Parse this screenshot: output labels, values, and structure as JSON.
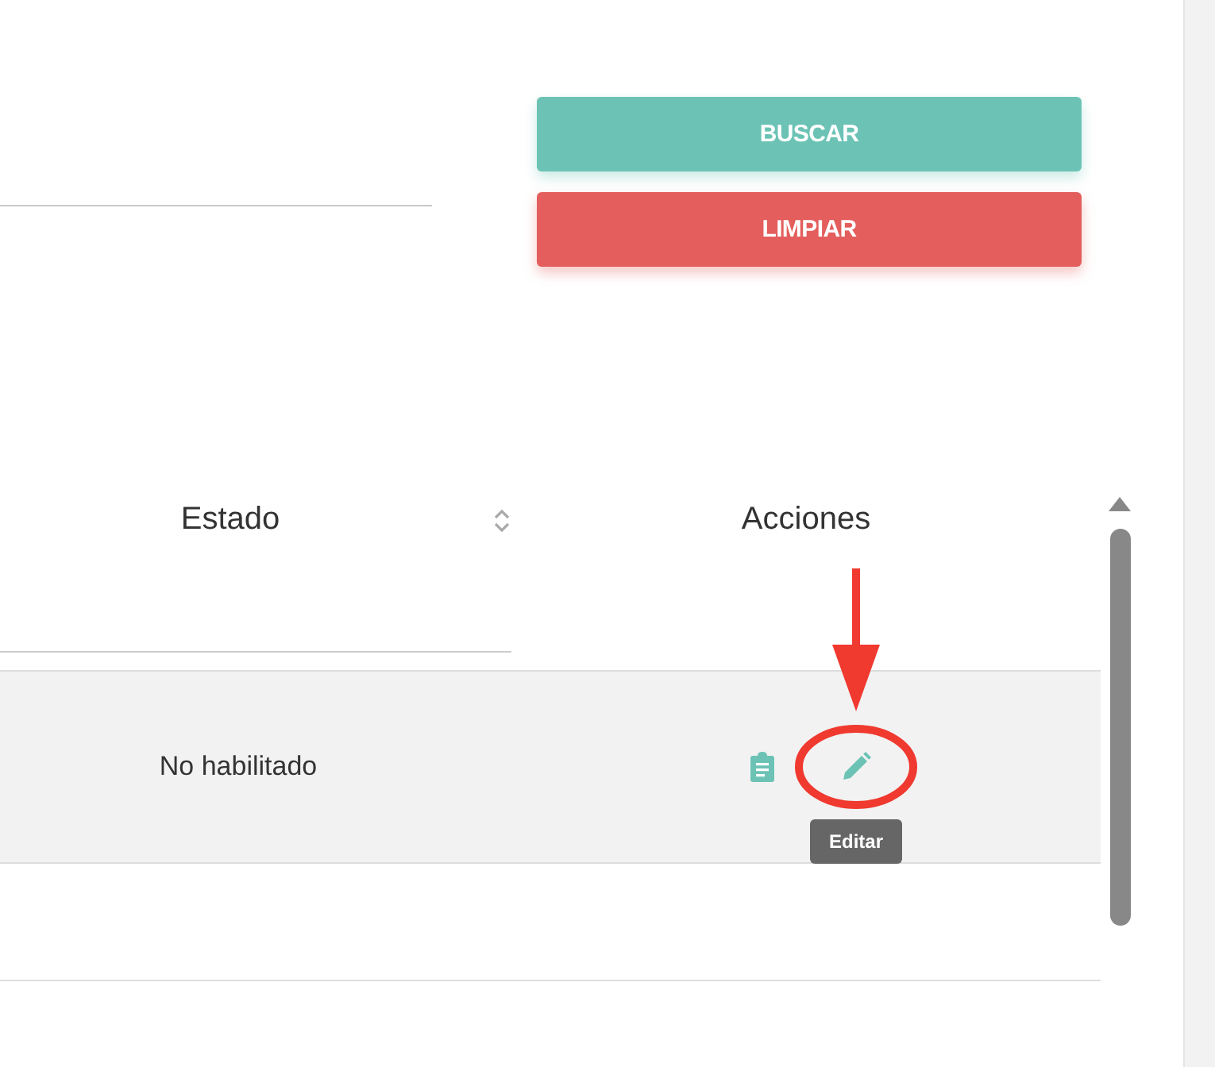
{
  "buttons": [
    {
      "label": "BUSCAR",
      "kind": "search"
    },
    {
      "label": "LIMPIAR",
      "kind": "clear"
    }
  ],
  "table": {
    "columns": [
      {
        "label": "Estado",
        "kind": "sortable_filter"
      },
      {
        "label": "Acciones",
        "kind": "plain"
      }
    ],
    "rows": [
      {
        "estado": "No habilitado",
        "hovered": true,
        "actions": [
          {
            "kind": "clipboard"
          },
          {
            "kind": "edit",
            "tooltip": "Editar"
          }
        ]
      }
    ]
  },
  "annotation": {
    "kind": "arrow_and_circle"
  }
}
